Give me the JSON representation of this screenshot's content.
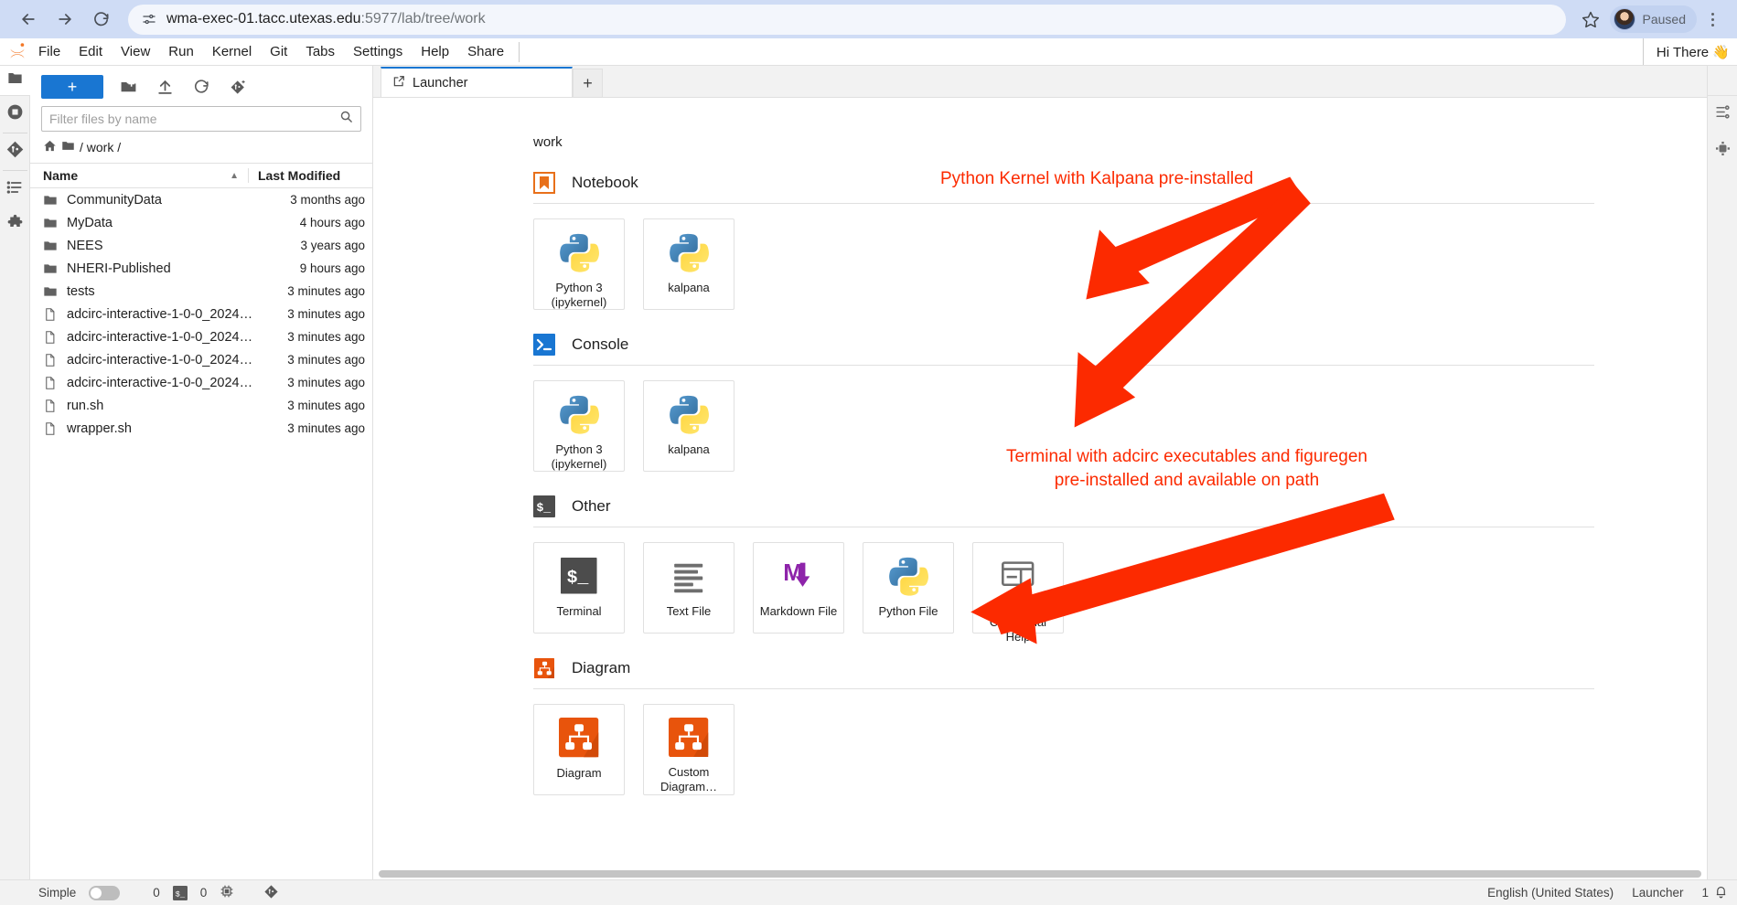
{
  "browser": {
    "back_icon": "back-arrow-icon",
    "forward_icon": "forward-arrow-icon",
    "reload_icon": "reload-icon",
    "site_settings_icon": "site-settings-icon",
    "url_host": "wma-exec-01.tacc.utexas.edu",
    "url_path": ":5977/lab/tree/work",
    "bookmark_icon": "star-icon",
    "profile_label": "Paused",
    "menu_icon": "kebab-menu-icon"
  },
  "menubar": {
    "logo": "jupyter-logo-icon",
    "items": [
      {
        "label": "File"
      },
      {
        "label": "Edit"
      },
      {
        "label": "View"
      },
      {
        "label": "Run"
      },
      {
        "label": "Kernel"
      },
      {
        "label": "Git"
      },
      {
        "label": "Tabs"
      },
      {
        "label": "Settings"
      },
      {
        "label": "Help"
      },
      {
        "label": "Share"
      }
    ],
    "greeting": "Hi There 👋"
  },
  "activity_bar": {
    "items": [
      {
        "icon": "folder-icon",
        "name": "file-browser"
      },
      {
        "icon": "running-terminals-icon",
        "name": "running-sessions"
      },
      {
        "icon": "git-icon",
        "name": "git-panel"
      },
      {
        "icon": "table-of-contents-icon",
        "name": "table-of-contents"
      },
      {
        "icon": "extension-puzzle-icon",
        "name": "extension-manager"
      }
    ]
  },
  "right_bar": {
    "items": [
      {
        "icon": "property-inspector-icon",
        "name": "property-inspector"
      },
      {
        "icon": "debugger-icon",
        "name": "debugger"
      }
    ]
  },
  "file_browser": {
    "new_launcher_label": "+",
    "toolbar_icons": [
      "new-folder-icon",
      "upload-icon",
      "refresh-icon",
      "new-git-clone-icon"
    ],
    "filter_placeholder": "Filter files by name",
    "filter_value": "",
    "search_icon": "search-icon",
    "breadcrumb": {
      "home_icon": "home-icon",
      "folder_icon": "folder-icon",
      "path": "/ work /"
    },
    "columns": {
      "name": "Name",
      "last_modified": "Last Modified"
    },
    "sort_caret": "▲",
    "rows": [
      {
        "type": "folder",
        "name": "CommunityData",
        "modified": "3 months ago"
      },
      {
        "type": "folder",
        "name": "MyData",
        "modified": "4 hours ago"
      },
      {
        "type": "folder",
        "name": "NEES",
        "modified": "3 years ago"
      },
      {
        "type": "folder",
        "name": "NHERI-Published",
        "modified": "9 hours ago"
      },
      {
        "type": "folder",
        "name": "tests",
        "modified": "3 minutes ago"
      },
      {
        "type": "file",
        "name": "adcirc-interactive-1-0-0_2024-…",
        "modified": "3 minutes ago"
      },
      {
        "type": "file",
        "name": "adcirc-interactive-1-0-0_2024-…",
        "modified": "3 minutes ago"
      },
      {
        "type": "file",
        "name": "adcirc-interactive-1-0-0_2024-…",
        "modified": "3 minutes ago"
      },
      {
        "type": "file",
        "name": "adcirc-interactive-1-0-0_2024-…",
        "modified": "3 minutes ago"
      },
      {
        "type": "file",
        "name": "run.sh",
        "modified": "3 minutes ago"
      },
      {
        "type": "file",
        "name": "wrapper.sh",
        "modified": "3 minutes ago"
      }
    ]
  },
  "tabbar": {
    "tabs": [
      {
        "label": "Launcher",
        "icon": "launcher-icon"
      }
    ],
    "add_tab_label": "+"
  },
  "launcher": {
    "cwd": "work",
    "sections": [
      {
        "title": "Notebook",
        "badge": "notebook-bookmark-icon",
        "cards": [
          {
            "label": "Python 3\n(ipykernel)",
            "icon": "python-icon"
          },
          {
            "label": "kalpana",
            "icon": "python-icon"
          }
        ]
      },
      {
        "title": "Console",
        "badge": "console-prompt-icon",
        "cards": [
          {
            "label": "Python 3\n(ipykernel)",
            "icon": "python-icon"
          },
          {
            "label": "kalpana",
            "icon": "python-icon"
          }
        ]
      },
      {
        "title": "Other",
        "badge": "terminal-prompt-icon",
        "cards": [
          {
            "label": "Terminal",
            "icon": "terminal-icon"
          },
          {
            "label": "Text File",
            "icon": "text-file-icon"
          },
          {
            "label": "Markdown File",
            "icon": "markdown-icon"
          },
          {
            "label": "Python File",
            "icon": "python-icon"
          },
          {
            "label": "Show\nContextual Help",
            "icon": "contextual-help-icon"
          }
        ]
      },
      {
        "title": "Diagram",
        "badge": "diagram-icon",
        "cards": [
          {
            "label": "Diagram",
            "icon": "diagram-icon"
          },
          {
            "label": "Custom\nDiagram…",
            "icon": "diagram-icon"
          }
        ]
      }
    ]
  },
  "annotations": {
    "color": "#fc2a00",
    "items": [
      {
        "text": "Python Kernel with Kalpana pre-installed"
      },
      {
        "text": "Terminal with adcirc executables and figuregen\npre-installed and available on path"
      }
    ]
  },
  "statusbar": {
    "simple_label": "Simple",
    "simple_on": false,
    "kernel_count": "0",
    "terminal_icon": "terminal-prompt-icon",
    "terminal_count": "0",
    "cpu_icon": "cpu-icon",
    "git_icon": "git-icon",
    "language": "English (United States)",
    "active_tab": "Launcher",
    "notification_count": "1",
    "bell_icon": "bell-icon"
  }
}
